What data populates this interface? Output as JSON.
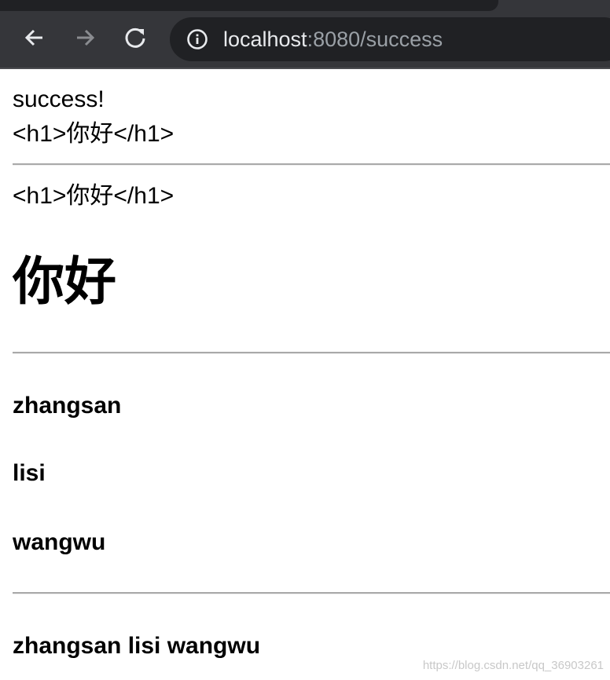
{
  "browser": {
    "url_host": "localhost",
    "url_rest": ":8080/success",
    "icons": {
      "back": "arrow-left-icon",
      "forward": "arrow-right-icon",
      "reload": "reload-icon",
      "info": "info-icon"
    },
    "colors": {
      "toolbar": "#35363a",
      "omnibox": "#202124"
    }
  },
  "page": {
    "text1": "success!",
    "text2": "<h1>你好</h1>",
    "text3": "<h1>你好</h1>",
    "heading": "你好",
    "names": [
      "zhangsan",
      "lisi",
      "wangwu"
    ],
    "names_inline": "zhangsan lisi wangwu"
  },
  "watermark": "https://blog.csdn.net/qq_36903261"
}
